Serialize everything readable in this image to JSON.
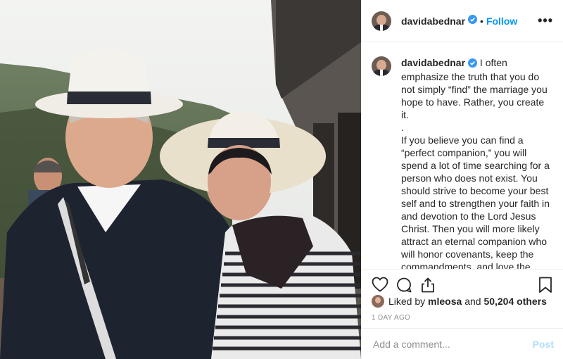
{
  "colors": {
    "accent": "#0095f6",
    "post_disabled": "#b2dffc",
    "muted": "#8e8e8e"
  },
  "header": {
    "username": "davidabednar",
    "verified_icon": "verified-badge-icon",
    "separator": "•",
    "follow_label": "Follow",
    "more_label": "•••"
  },
  "caption": {
    "username": "davidabednar",
    "text": "I often emphasize the truth that you do not simply “find” the marriage you hope to have. Rather, you create it.\n.\nIf you believe you can find a “perfect companion,” you will spend a lot of time searching for a person who does not exist. You should strive to become your best self and to strengthen your faith in and devotion to the Lord Jesus Christ. Then you will more likely attract an eternal companion who will honor covenants, keep the commandments, and love the Lord.\n.\nWhen you and your spouse remain steadfast on the covenant path, you will have heavenly help to create the marriage you hope to have."
  },
  "actions": {
    "like_icon": "heart-icon",
    "comment_icon": "comment-icon",
    "share_icon": "share-icon",
    "save_icon": "bookmark-icon"
  },
  "likes": {
    "prefix": "Liked by",
    "user": "mleosa",
    "middle": "and",
    "count": "50,204 others"
  },
  "timestamp": "1 DAY AGO",
  "comment_box": {
    "placeholder": "Add a comment...",
    "post_label": "Post"
  }
}
